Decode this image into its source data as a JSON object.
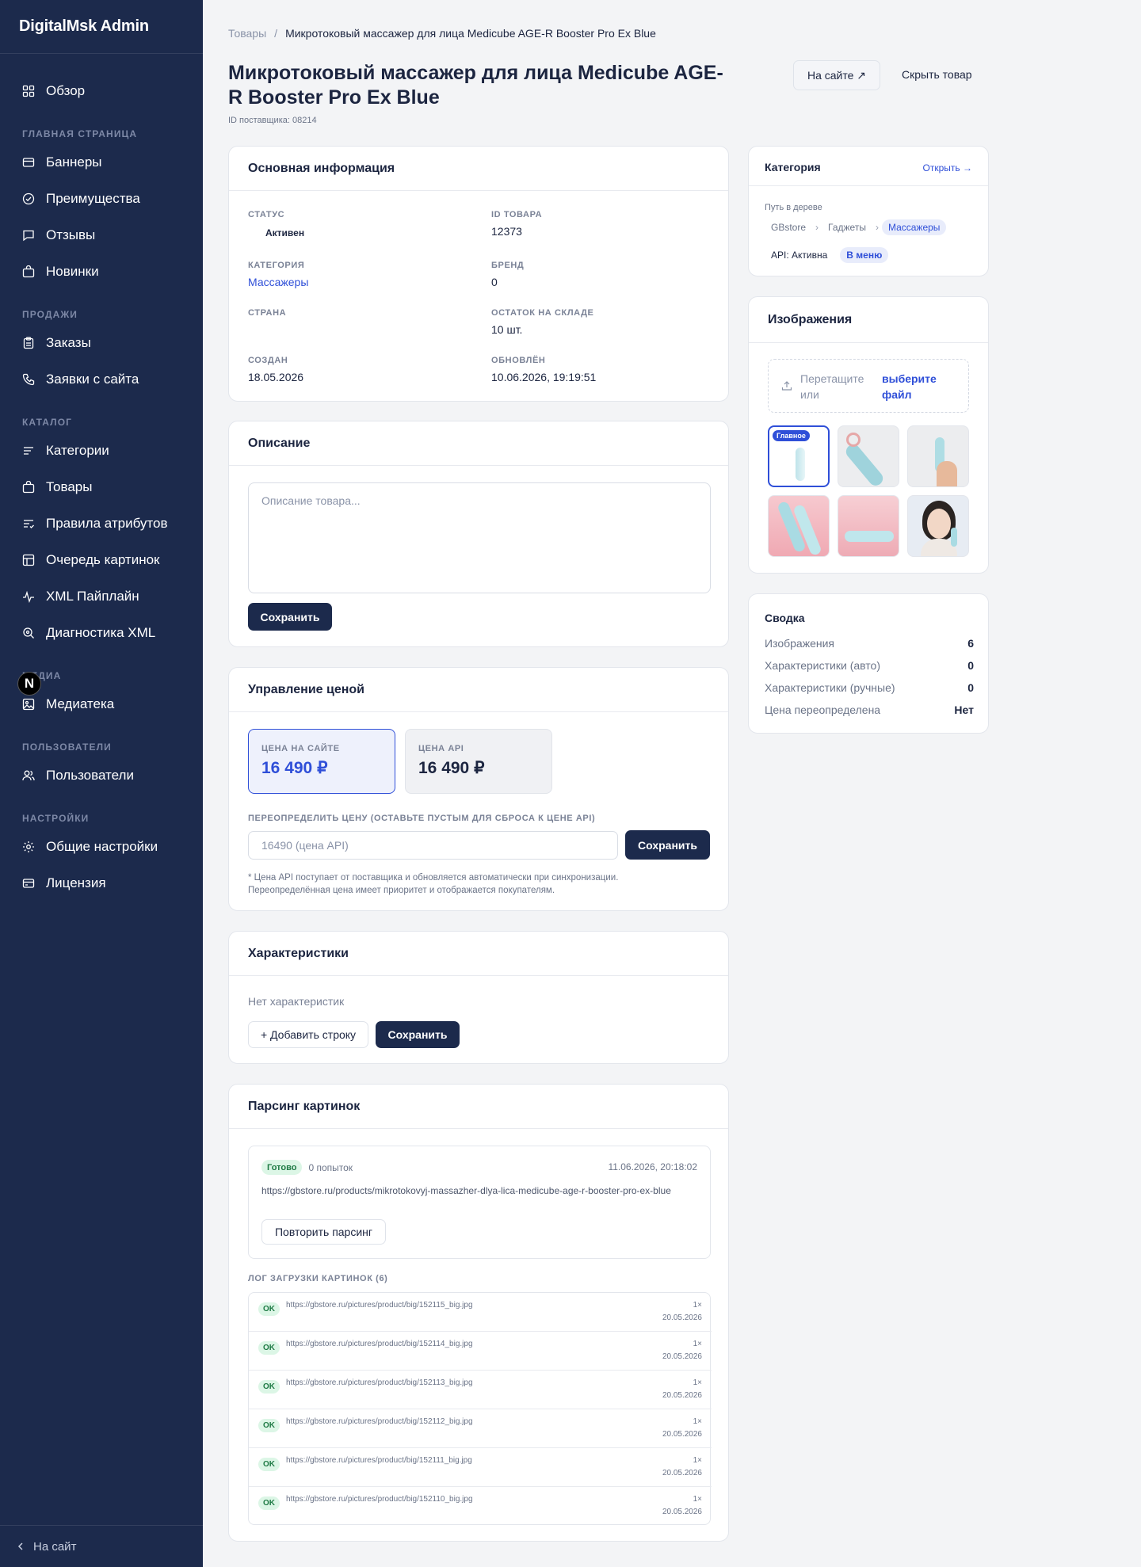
{
  "app": {
    "title": "DigitalMsk Admin"
  },
  "sidebar": {
    "overview": "Обзор",
    "sections": [
      {
        "title": "ГЛАВНАЯ СТРАНИЦА",
        "items": [
          "Баннеры",
          "Преимущества",
          "Отзывы",
          "Новинки"
        ]
      },
      {
        "title": "ПРОДАЖИ",
        "items": [
          "Заказы",
          "Заявки с сайта"
        ]
      },
      {
        "title": "КАТАЛОГ",
        "items": [
          "Категории",
          "Товары",
          "Правила атрибутов",
          "Очередь картинок",
          "XML Пайплайн",
          "Диагностика XML"
        ]
      },
      {
        "title": "МЕДИА",
        "items": [
          "Медиатека"
        ]
      },
      {
        "title": "ПОЛЬЗОВАТЕЛИ",
        "items": [
          "Пользователи"
        ]
      },
      {
        "title": "НАСТРОЙКИ",
        "items": [
          "Общие настройки",
          "Лицензия"
        ]
      }
    ],
    "footer": "На сайт",
    "overlay_badge": "N"
  },
  "breadcrumb": {
    "root": "Товары",
    "sep": "/",
    "current": "Микротоковый массажер для лица Medicube AGE-R Booster Pro Ex Blue"
  },
  "page": {
    "title": "Микротоковый массажер для лица Medicube AGE-R Booster Pro Ex Blue",
    "supplier_id": "ID поставщика: 08214",
    "on_site_button": "На сайте ↗",
    "hide_button": "Скрыть товар"
  },
  "basic_info": {
    "title": "Основная информация",
    "status_label": "СТАТУС",
    "status_value": "Активен",
    "id_label": "ID ТОВАРА",
    "id_value": "12373",
    "category_label": "КАТЕГОРИЯ",
    "category_value": "Массажеры",
    "brand_label": "БРЕНД",
    "brand_value": "0",
    "country_label": "СТРАНА",
    "country_value": "",
    "stock_label": "ОСТАТОК НА СКЛАДЕ",
    "stock_value": "10 шт.",
    "created_label": "СОЗДАН",
    "created_value": "18.05.2026",
    "updated_label": "ОБНОВЛЁН",
    "updated_value": "10.06.2026, 19:19:51"
  },
  "description": {
    "title": "Описание",
    "placeholder": "Описание товара...",
    "save": "Сохранить"
  },
  "price": {
    "title": "Управление ценой",
    "site_label": "ЦЕНА НА САЙТЕ",
    "site_value": "16 490 ₽",
    "api_label": "ЦЕНА API",
    "api_value": "16 490 ₽",
    "override_label": "ПЕРЕОПРЕДЕЛИТЬ ЦЕНУ (ОСТАВЬТЕ ПУСТЫМ ДЛЯ СБРОСА К ЦЕНЕ API)",
    "override_placeholder": "16490 (цена API)",
    "save": "Сохранить",
    "note1": "* Цена API поступает от поставщика и обновляется автоматически при синхронизации.",
    "note2": "Переопределённая цена имеет приоритет и отображается покупателям."
  },
  "specs": {
    "title": "Характеристики",
    "empty": "Нет характеристик",
    "add_row": "+ Добавить строку",
    "save": "Сохранить"
  },
  "parsing": {
    "title": "Парсинг картинок",
    "status": "Готово",
    "attempts": "0 попыток",
    "timestamp": "11.06.2026, 20:18:02",
    "url": "https://gbstore.ru/products/mikrotokovyj-massazher-dlya-lica-medicube-age-r-booster-pro-ex-blue",
    "retry": "Повторить парсинг",
    "log_title": "ЛОГ ЗАГРУЗКИ КАРТИНОК (6)",
    "log": [
      {
        "status": "OK",
        "url": "https://gbstore.ru/pictures/product/big/152115_big.jpg",
        "count": "1×",
        "date": "20.05.2026"
      },
      {
        "status": "OK",
        "url": "https://gbstore.ru/pictures/product/big/152114_big.jpg",
        "count": "1×",
        "date": "20.05.2026"
      },
      {
        "status": "OK",
        "url": "https://gbstore.ru/pictures/product/big/152113_big.jpg",
        "count": "1×",
        "date": "20.05.2026"
      },
      {
        "status": "OK",
        "url": "https://gbstore.ru/pictures/product/big/152112_big.jpg",
        "count": "1×",
        "date": "20.05.2026"
      },
      {
        "status": "OK",
        "url": "https://gbstore.ru/pictures/product/big/152111_big.jpg",
        "count": "1×",
        "date": "20.05.2026"
      },
      {
        "status": "OK",
        "url": "https://gbstore.ru/pictures/product/big/152110_big.jpg",
        "count": "1×",
        "date": "20.05.2026"
      }
    ]
  },
  "category_card": {
    "title": "Категория",
    "open": "Открыть →",
    "path_label": "Путь в дереве",
    "path": [
      "GBstore",
      "Гаджеты",
      "Массажеры"
    ],
    "api_status": "API: Активна",
    "menu_badge": "В меню"
  },
  "images": {
    "title": "Изображения",
    "drop_text": "Перетащите или",
    "choose_file": "выберите файл",
    "main_badge": "Главное"
  },
  "summary": {
    "title": "Сводка",
    "rows": [
      {
        "label": "Изображения",
        "value": "6"
      },
      {
        "label": "Характеристики (авто)",
        "value": "0"
      },
      {
        "label": "Характеристики (ручные)",
        "value": "0"
      },
      {
        "label": "Цена переопределена",
        "value": "Нет"
      }
    ]
  },
  "colors": {
    "sidebar": "#1c2a4c",
    "accent": "#2f4fd8",
    "success_bg": "#dcf6e6",
    "success_text": "#1e7a44"
  }
}
